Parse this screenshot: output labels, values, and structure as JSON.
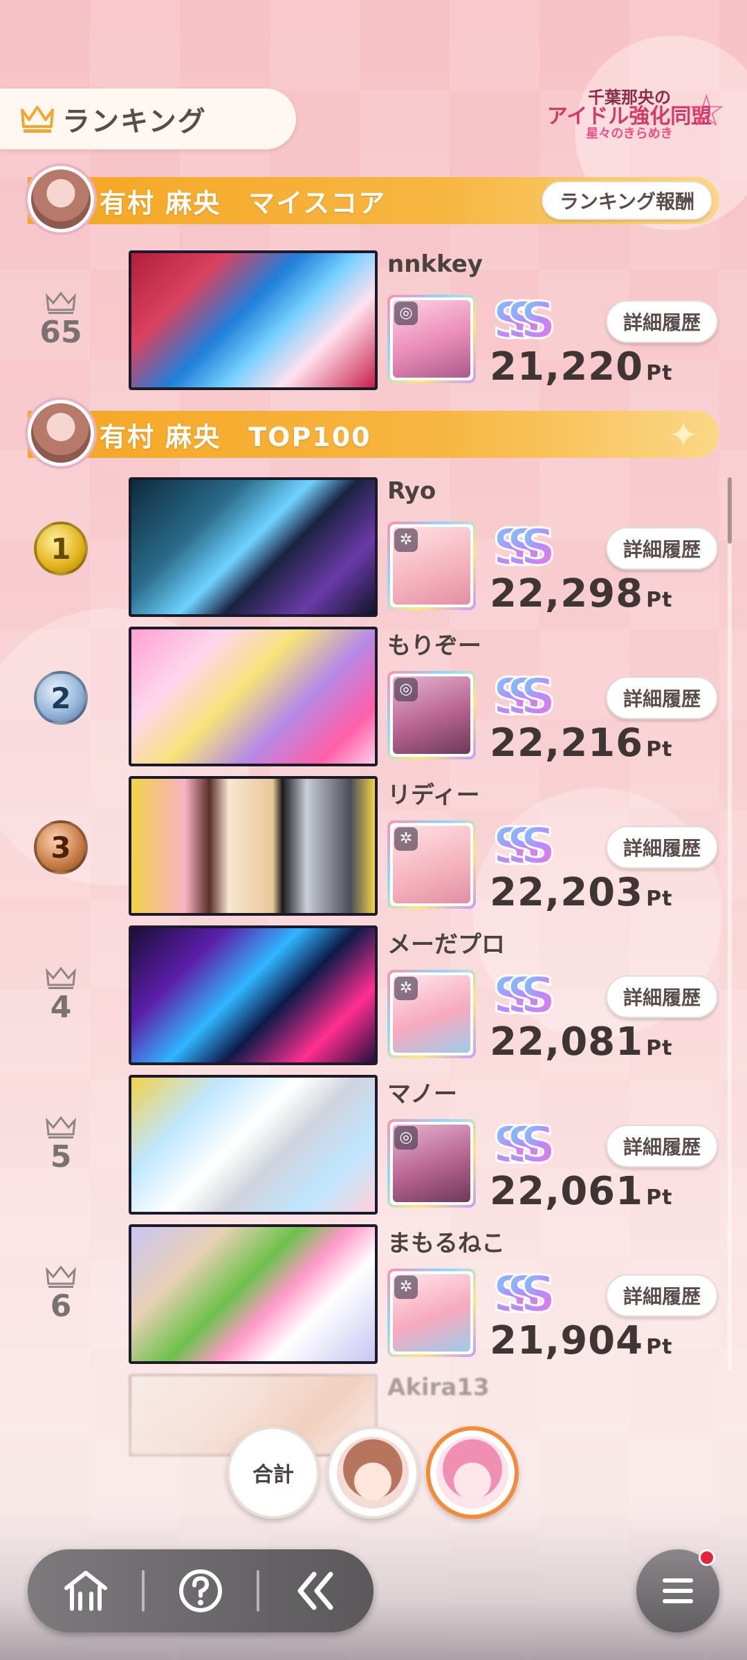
{
  "header": {
    "title": "ランキング",
    "event_logo_line1": "千葉那央の",
    "event_logo_line2": "アイドル強化同盟",
    "event_logo_sub": "星々のきらめき"
  },
  "my_score": {
    "section_label": "有村 麻央　マイスコア",
    "reward_button": "ランキング報酬",
    "entry": {
      "rank": "65",
      "name": "nnkkey",
      "score": "21,220",
      "unit": "Pt",
      "detail_label": "詳細履歴"
    }
  },
  "top100": {
    "section_label": "有村 麻央　TOP100",
    "entries": [
      {
        "rank": "1",
        "name": "Ryo",
        "score": "22,298",
        "unit": "Pt",
        "detail_label": "詳細履歴"
      },
      {
        "rank": "2",
        "name": "もりぞー",
        "score": "22,216",
        "unit": "Pt",
        "detail_label": "詳細履歴"
      },
      {
        "rank": "3",
        "name": "リディー",
        "score": "22,203",
        "unit": "Pt",
        "detail_label": "詳細履歴"
      },
      {
        "rank": "4",
        "name": "メーだプロ",
        "score": "22,081",
        "unit": "Pt",
        "detail_label": "詳細履歴"
      },
      {
        "rank": "5",
        "name": "マノー",
        "score": "22,061",
        "unit": "Pt",
        "detail_label": "詳細履歴"
      },
      {
        "rank": "6",
        "name": "まもるねこ",
        "score": "21,904",
        "unit": "Pt",
        "detail_label": "詳細履歴"
      },
      {
        "rank": "",
        "name": "Akira13",
        "score": "",
        "unit": "",
        "detail_label": ""
      }
    ]
  },
  "filters": {
    "total_label": "合計"
  },
  "nav": {
    "home_icon": "home-icon",
    "help_icon": "help-icon",
    "back_icon": "back-icon",
    "menu_icon": "menu-icon"
  },
  "colors": {
    "accent_orange": "#f5a623",
    "active_ring": "#f48b3a",
    "notification": "#e8223a"
  }
}
